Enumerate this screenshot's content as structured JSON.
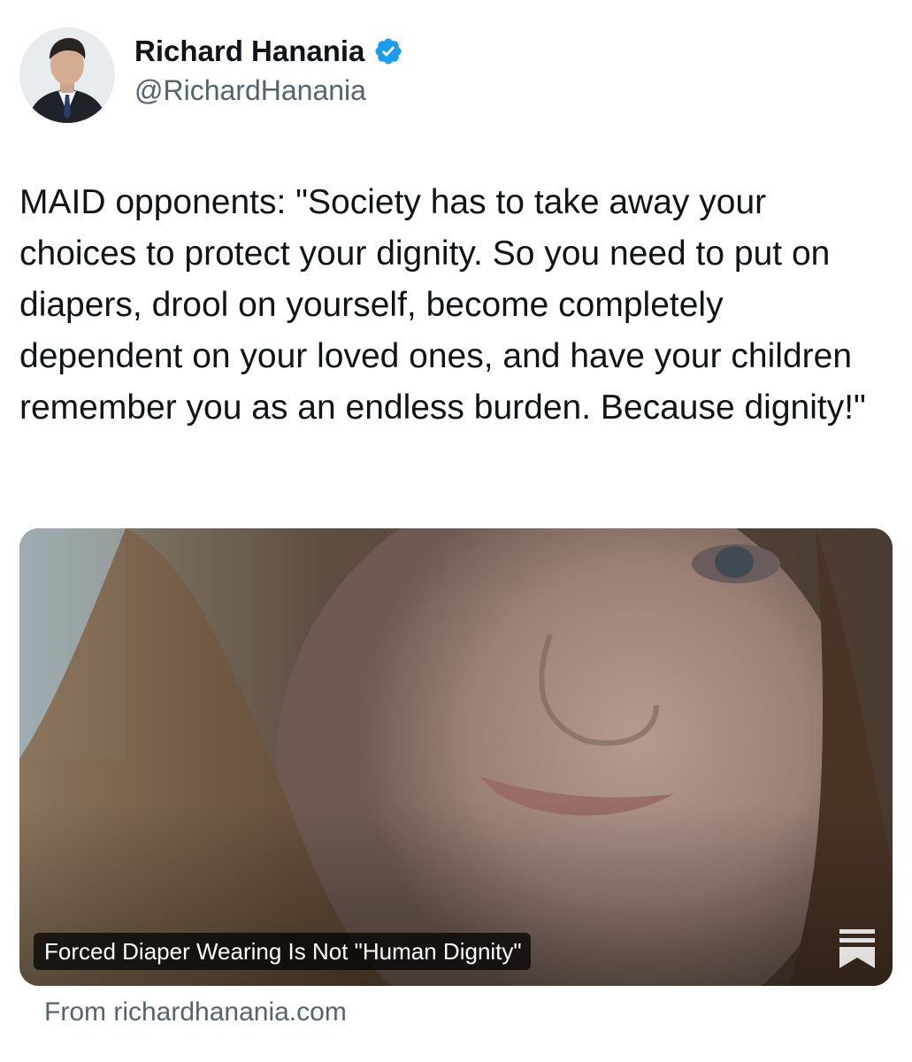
{
  "author": {
    "display_name": "Richard Hanania",
    "handle": "@RichardHanania",
    "verified": true,
    "verified_color": "#1d9bf0",
    "avatar_icon": "profile-photo"
  },
  "tweet": {
    "text": "MAID opponents: \"Society has to take away your choices to protect your dignity. So you need to put on diapers, drool on yourself, become completely dependent on your loved ones, and have your children remember you as an endless burden. Because dignity!\""
  },
  "link_card": {
    "title": "Forced Diaper Wearing Is Not \"Human Dignity\"",
    "source": "From richardhanania.com",
    "image_icon": "article-photo",
    "badge_icon": "substack-bookmark-icon"
  },
  "colors": {
    "text_primary": "#0f1419",
    "text_secondary": "#536471",
    "accent": "#1d9bf0"
  }
}
